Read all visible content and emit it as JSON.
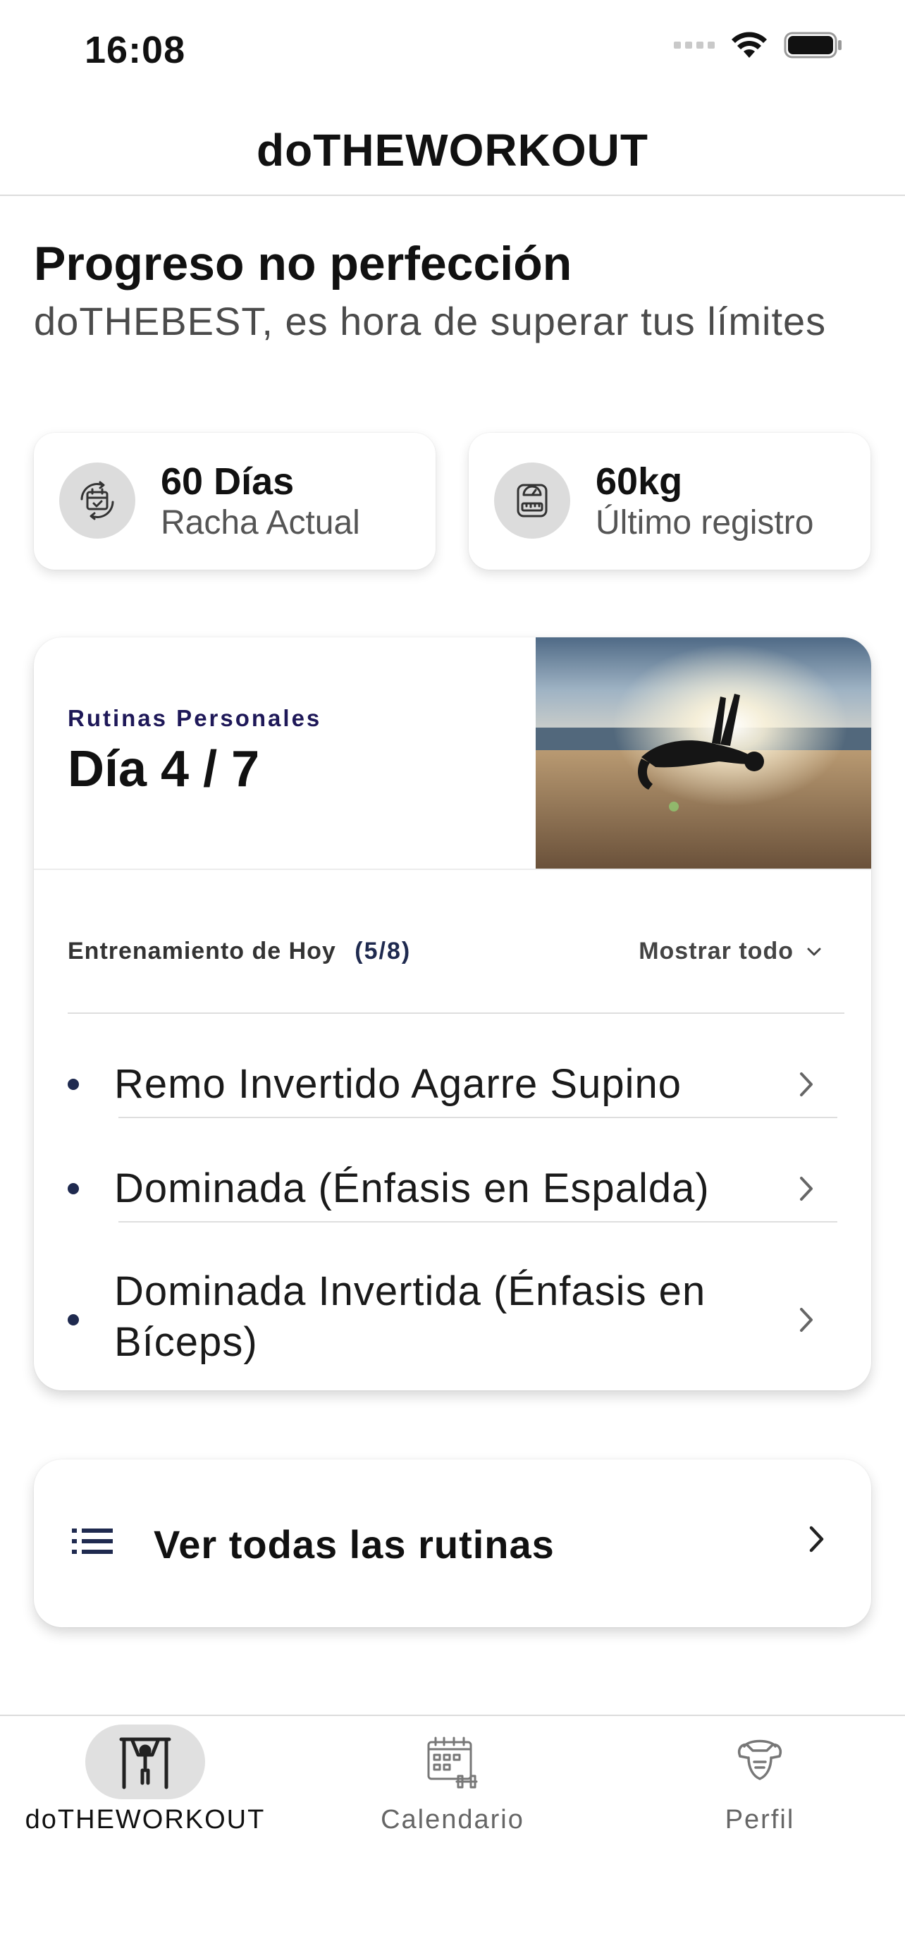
{
  "status_bar": {
    "time": "16:08"
  },
  "header": {
    "title": "doTHEWORKOUT"
  },
  "greeting": {
    "title": "Progreso no perfección",
    "subtitle": "doTHEBEST, es hora de superar tus límites"
  },
  "stats": [
    {
      "value": "60 Días",
      "label": "Racha Actual",
      "icon": "streak-calendar-icon"
    },
    {
      "value": "60kg",
      "label": "Último registro",
      "icon": "scale-icon"
    }
  ],
  "routine": {
    "kicker": "Rutinas Personales",
    "day": "Día 4 / 7",
    "image": "backflip-on-beach-photo",
    "today_label": "Entrenamiento de Hoy",
    "today_count": "(5/8)",
    "show_all_label": "Mostrar todo",
    "exercises": [
      "Remo Invertido Agarre Supino",
      "Dominada (Énfasis en Espalda)",
      "Dominada Invertida (Énfasis en Bíceps)"
    ]
  },
  "all_routines": {
    "label": "Ver todas las rutinas"
  },
  "tabs": [
    {
      "label": "doTHEWORKOUT",
      "icon": "pullup-bar-icon",
      "active": true
    },
    {
      "label": "Calendario",
      "icon": "calendar-dumbbell-icon",
      "active": false
    },
    {
      "label": "Perfil",
      "icon": "muscle-torso-icon",
      "active": false
    }
  ],
  "colors": {
    "accent": "#1f2a4f",
    "kicker": "#1e1858",
    "inactive_tab": "#666666"
  }
}
